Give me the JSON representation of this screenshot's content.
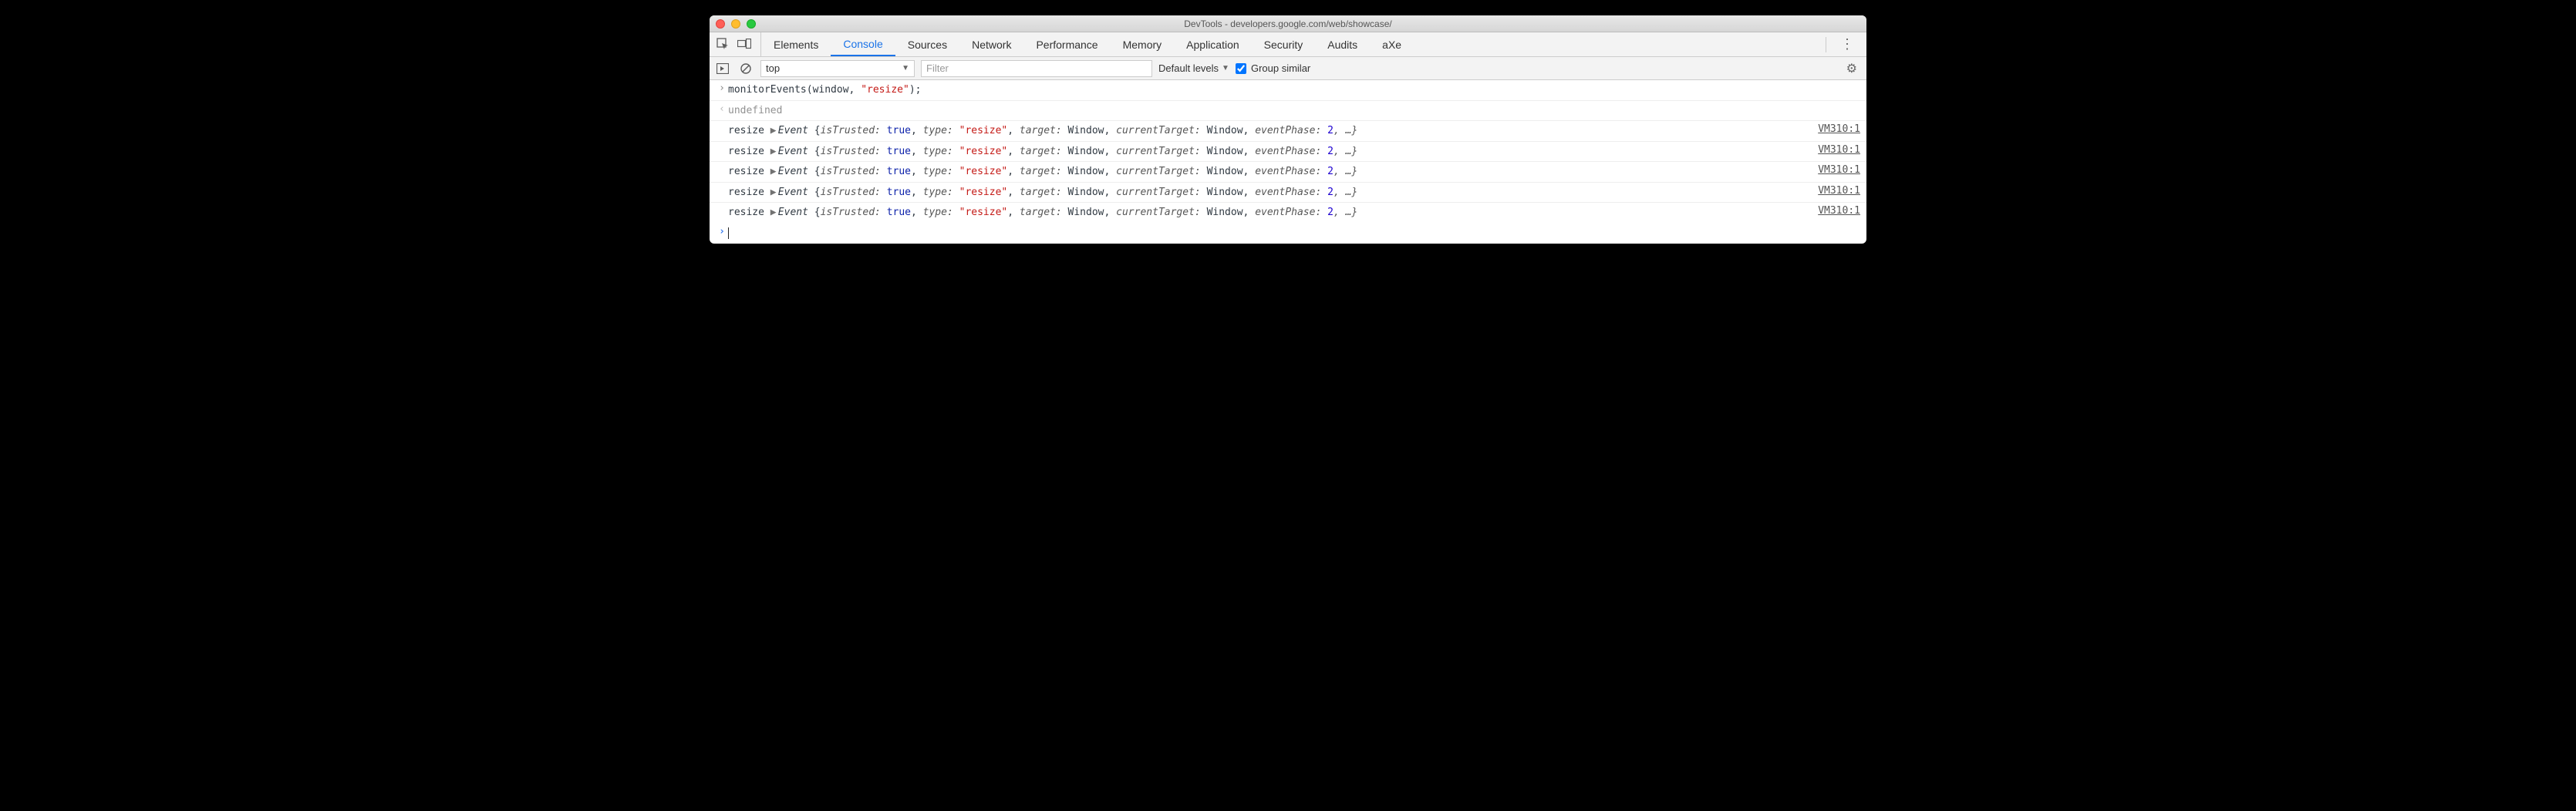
{
  "window": {
    "title": "DevTools - developers.google.com/web/showcase/"
  },
  "tabs": {
    "items": [
      "Elements",
      "Console",
      "Sources",
      "Network",
      "Performance",
      "Memory",
      "Application",
      "Security",
      "Audits",
      "aXe"
    ],
    "active": "Console"
  },
  "toolbar": {
    "context": "top",
    "filter_placeholder": "Filter",
    "levels_label": "Default levels",
    "group_similar_label": "Group similar",
    "group_similar_checked": true
  },
  "console": {
    "input": {
      "fn": "monitorEvents",
      "arg1": "window",
      "arg2": "\"resize\"",
      "suffix": ");"
    },
    "output_undefined": "undefined",
    "event_log": {
      "prefix": "resize",
      "obj_name": "Event",
      "body_open": " {",
      "k_isTrusted": "isTrusted:",
      "v_true": "true",
      "sep": ", ",
      "k_type": "type:",
      "v_resize": "\"resize\"",
      "k_target": "target:",
      "v_window": "Window",
      "k_currentTarget": "currentTarget:",
      "k_eventPhase": "eventPhase:",
      "v_2": "2",
      "ellipsis": ", …}",
      "source": "VM310:1"
    },
    "row_count": 5
  }
}
